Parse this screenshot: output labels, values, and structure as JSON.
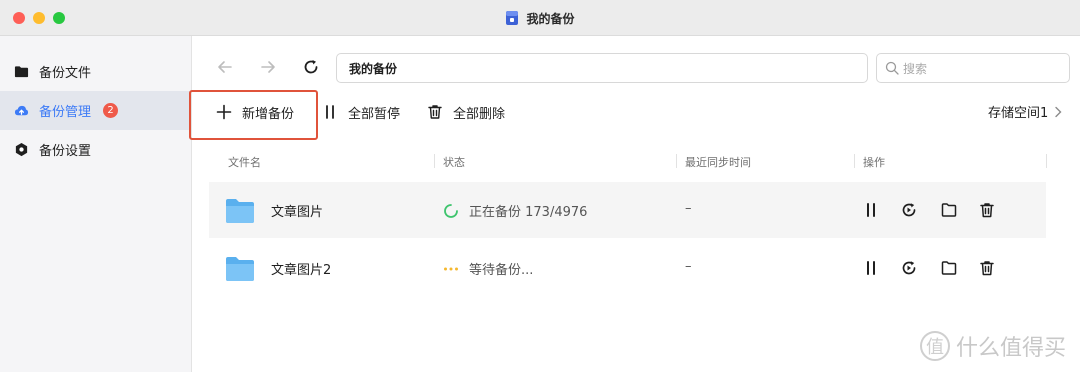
{
  "window": {
    "title": "我的备份"
  },
  "sidebar": {
    "items": [
      {
        "label": "备份文件",
        "icon": "folder-icon",
        "active": false
      },
      {
        "label": "备份管理",
        "icon": "cloud-upload-icon",
        "active": true,
        "badge": "2"
      },
      {
        "label": "备份设置",
        "icon": "settings-hexagon-icon",
        "active": false
      }
    ]
  },
  "toolbar": {
    "path": "我的备份",
    "search_placeholder": "搜索",
    "new_backup_label": "新增备份",
    "pause_all_label": "全部暂停",
    "delete_all_label": "全部删除",
    "storage_label": "存储空间1"
  },
  "table": {
    "headers": [
      "文件名",
      "状态",
      "最近同步时间",
      "操作"
    ],
    "rows": [
      {
        "name": "文章图片",
        "status": "正在备份 173/4976",
        "status_kind": "in-progress",
        "last_sync": "–"
      },
      {
        "name": "文章图片2",
        "status": "等待备份...",
        "status_kind": "waiting",
        "last_sync": "–"
      }
    ]
  },
  "watermark": {
    "text": "什么值得买",
    "glyph": "值"
  },
  "colors": {
    "accent": "#3d7bf6",
    "badge": "#ef5a4a",
    "highlight_border": "#e0533b",
    "progress_green": "#3ec46d",
    "waiting_yellow": "#f5b82e",
    "folder_blue": "#5ab0ee"
  }
}
